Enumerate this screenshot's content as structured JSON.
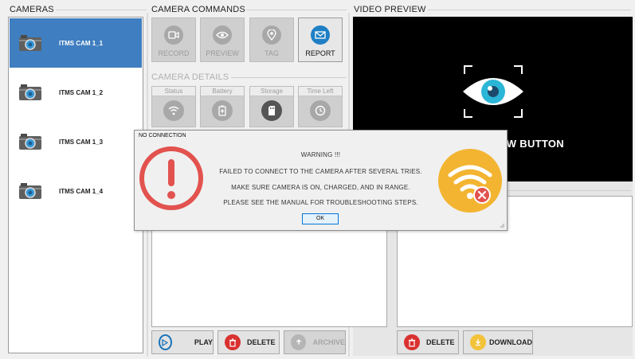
{
  "sections": {
    "cameras": "CAMERAS",
    "commands": "CAMERA COMMANDS",
    "details": "CAMERA DETAILS",
    "preview": "VIDEO PREVIEW"
  },
  "cameras": [
    {
      "label": "ITMS CAM 1_1",
      "selected": true
    },
    {
      "label": "ITMS CAM 1_2",
      "selected": false
    },
    {
      "label": "ITMS CAM 1_3",
      "selected": false
    },
    {
      "label": "ITMS CAM 1_4",
      "selected": false
    }
  ],
  "commands": {
    "record": "RECORD",
    "preview": "PREVIEW",
    "tag": "TAG",
    "report": "REPORT"
  },
  "details": {
    "status": "Status",
    "battery": "Battery",
    "storage": "Storage",
    "time_left": "Time Left"
  },
  "preview_text": "W BUTTON",
  "left_buttons": {
    "play": "PLAY",
    "delete": "DELETE",
    "archive": "ARCHIVE"
  },
  "right_buttons": {
    "delete": "DELETE",
    "download": "DOWNLOAD"
  },
  "dialog": {
    "title": "NO CONNECTION",
    "line1": "WARNING !!!",
    "line2": "FAILED TO CONNECT TO THE CAMERA AFTER SEVERAL TRIES.",
    "line3": "MAKE SURE CAMERA IS ON, CHARGED, AND IN RANGE.",
    "line4": "PLEASE SEE THE MANUAL FOR TROUBLESHOOTING STEPS.",
    "ok": "OK"
  },
  "colors": {
    "selected": "#3f7ec0",
    "error_red": "#e2524e",
    "wifi_orange": "#f3b431",
    "report_blue": "#1f7fc4",
    "play_blue": "#1a74b8",
    "delete_red": "#d9312f",
    "download_yellow": "#f3c23b"
  }
}
